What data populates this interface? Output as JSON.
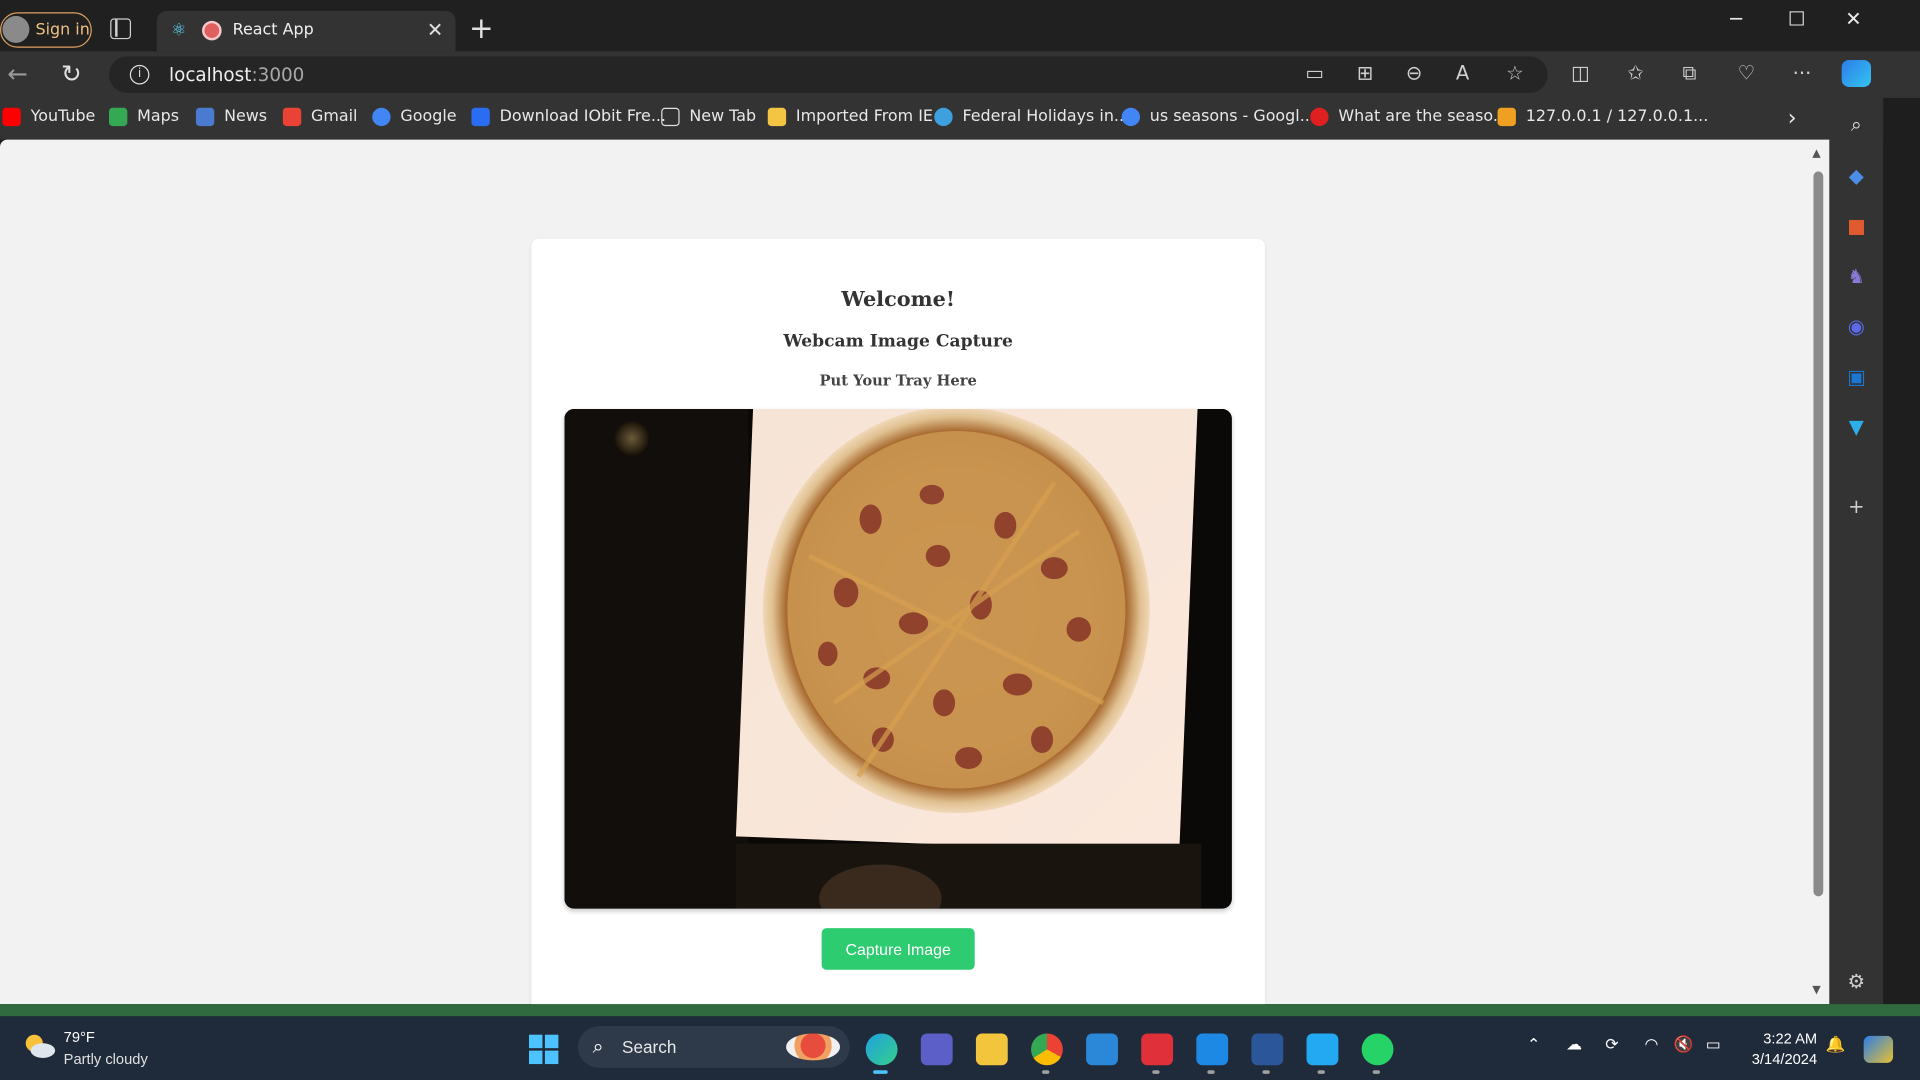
{
  "browser": {
    "signin_label": "Sign in",
    "tab_title": "React App",
    "url_host": "localhost",
    "url_port": ":3000",
    "bookmarks": [
      {
        "label": "YouTube",
        "color": "#ff0000"
      },
      {
        "label": "Maps",
        "color": "#34a853"
      },
      {
        "label": "News",
        "color": "#4a7bd0"
      },
      {
        "label": "Gmail",
        "color": "#ea4335"
      },
      {
        "label": "Google",
        "color": "#4285f4"
      },
      {
        "label": "Download IObit Fre...",
        "color": "#2b6df2"
      },
      {
        "label": "New Tab",
        "color": "#e0e0e0"
      },
      {
        "label": "Imported From IE",
        "color": "#f4c542"
      },
      {
        "label": "Federal Holidays in...",
        "color": "#3fa0e0"
      },
      {
        "label": "us seasons - Googl...",
        "color": "#4285f4"
      },
      {
        "label": "What are the seaso...",
        "color": "#e02020"
      },
      {
        "label": "127.0.0.1 / 127.0.0.1...",
        "color": "#f0a020"
      }
    ]
  },
  "app": {
    "welcome": "Welcome!",
    "title": "Webcam Image Capture",
    "subtitle": "Put Your Tray Here",
    "capture_button": "Capture Image"
  },
  "taskbar": {
    "weather_temp": "79°F",
    "weather_desc": "Partly cloudy",
    "search_label": "Search",
    "time": "3:22 AM",
    "date": "3/14/2024"
  },
  "colors": {
    "accent_button": "#2ecc71",
    "page_bg": "#f2f2f2",
    "browser_chrome": "#333333"
  }
}
